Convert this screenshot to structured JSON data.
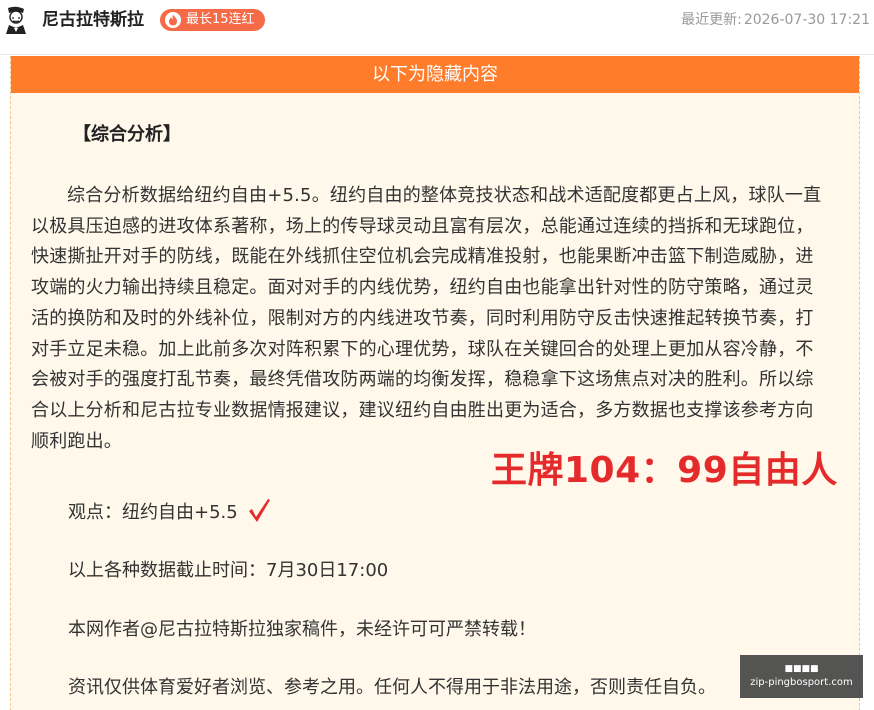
{
  "header": {
    "author_name": "尼古拉特斯拉",
    "streak_badge": "最长15连红",
    "updated_label": "最近更新:",
    "updated_time": "2026-07-30 17:21"
  },
  "panel": {
    "banner_text": "以下为隐藏内容",
    "section_title": "【综合分析】",
    "paragraph_lines": [
      "综合分析数据给纽约自由+5.5。纽约自由的整体竞技状态和战术适配度都更占上风，球队一直",
      "以极具压迫感的进攻体系著称，场上的传导球灵动且富有层次，总能通过连续的挡拆和无球跑位，",
      "快速撕扯开对手的防线，既能在外线抓住空位机会完成精准投射，也能果断冲击篮下制造威胁，进",
      "攻端的火力输出持续且稳定。面对对手的内线优势，纽约自由也能拿出针对性的防守策略，通过灵",
      "活的换防和及时的外线补位，限制对方的内线进攻节奏，同时利用防守反击快速推起转换节奏，打",
      "对手立足未稳。加上此前多次对阵积累下的心理优势，球队在关键回合的处理上更加从容冷静，不",
      "会被对手的强度打乱节奏，最终凭借攻防两端的均衡发挥，稳稳拿下这场焦点对决的胜利。所以综",
      "合以上分析和尼古拉专业数据情报建议，建议纽约自由胜出更为适合，多方数据也支撑该参考方向",
      "顺利跑出。"
    ],
    "result_annotation": "王牌104：99自由人",
    "opinion": "观点：纽约自由+5.5",
    "deadline": "以上各种数据截止时间：7月30日17:00",
    "copyright": "本网作者@尼古拉特斯拉独家稿件，未经许可可严禁转载！",
    "disclaimer": "资讯仅供体育爱好者浏览、参考之用。任何人不得用于非法用途，否则责任自负。"
  },
  "watermark": {
    "top_text": "■■■■",
    "url_text": "zip-pingbosport.com"
  },
  "colors": {
    "banner_orange": "#fe7c2a",
    "panel_bg": "#fff8eb",
    "streak_badge": "#f56b48",
    "result_red": "#e42a2a"
  },
  "icons": {
    "avatar": "avatar-portrait",
    "streak": "flame-icon",
    "check": "checkmark-icon"
  }
}
